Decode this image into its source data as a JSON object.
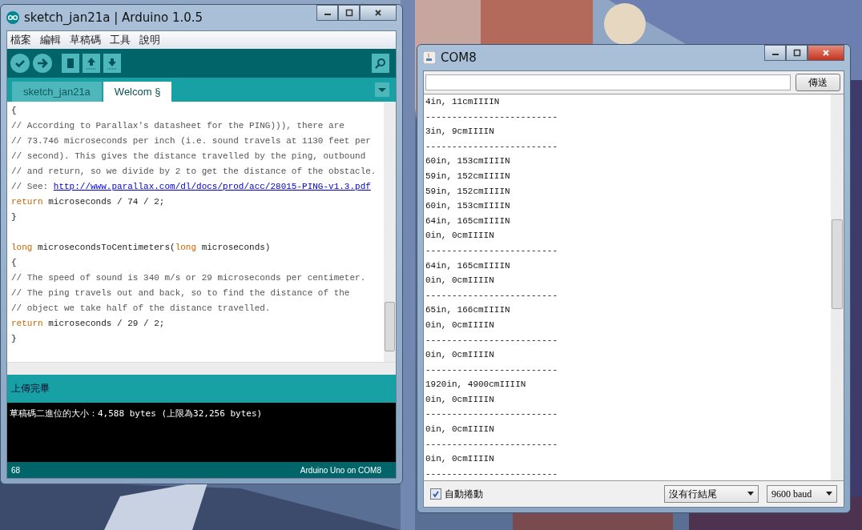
{
  "arduino": {
    "title": "sketch_jan21a | Arduino 1.0.5",
    "menu": [
      "檔案",
      "編輯",
      "草稿碼",
      "工具",
      "說明"
    ],
    "tabs": [
      {
        "label": "sketch_jan21a",
        "selected": false
      },
      {
        "label": "Welcom §",
        "selected": true
      }
    ],
    "code": [
      [
        {
          "kind": "plain",
          "text": "{"
        }
      ],
      [
        {
          "kind": "comment",
          "text": "// According to Parallax's datasheet for the PING))), there are"
        }
      ],
      [
        {
          "kind": "comment",
          "text": "// 73.746 microseconds per inch (i.e. sound travels at 1130 feet per"
        }
      ],
      [
        {
          "kind": "comment",
          "text": "// second). This gives the distance travelled by the ping, outbound"
        }
      ],
      [
        {
          "kind": "comment",
          "text": "// and return, so we divide by 2 to get the distance of the obstacle."
        }
      ],
      [
        {
          "kind": "comment",
          "text": "// See: "
        },
        {
          "kind": "link",
          "text": "http://www.parallax.com/dl/docs/prod/acc/28015-PING-v1.3.pdf"
        }
      ],
      [
        {
          "kind": "keyword",
          "text": "return"
        },
        {
          "kind": "plain",
          "text": " microseconds / 74 / 2;"
        }
      ],
      [
        {
          "kind": "plain",
          "text": "}"
        }
      ],
      [
        {
          "kind": "blank"
        }
      ],
      [
        {
          "kind": "keyword",
          "text": "long"
        },
        {
          "kind": "plain",
          "text": " microsecondsToCentimeters("
        },
        {
          "kind": "keyword",
          "text": "long"
        },
        {
          "kind": "plain",
          "text": " microseconds)"
        }
      ],
      [
        {
          "kind": "plain",
          "text": "{"
        }
      ],
      [
        {
          "kind": "comment",
          "text": "// The speed of sound is 340 m/s or 29 microseconds per centimeter."
        }
      ],
      [
        {
          "kind": "comment",
          "text": "// The ping travels out and back, so to find the distance of the"
        }
      ],
      [
        {
          "kind": "comment",
          "text": "// object we take half of the distance travelled."
        }
      ],
      [
        {
          "kind": "keyword",
          "text": "return"
        },
        {
          "kind": "plain",
          "text": " microseconds / 29 / 2;"
        }
      ],
      [
        {
          "kind": "plain",
          "text": "}"
        }
      ]
    ],
    "status": "上傳完畢",
    "console": [
      "草稿碼二進位的大小：4,588 bytes (上限為32,256 bytes)"
    ],
    "line_number": "68",
    "board": "Arduino Uno on COM8"
  },
  "serial": {
    "title": "COM8",
    "send_button": "傳送",
    "lines": [
      "4in, 11cmIIIIN",
      "-------------------------",
      "3in, 9cmIIIIN",
      "-------------------------",
      "60in, 153cmIIIIN",
      "59in, 152cmIIIIN",
      "59in, 152cmIIIIN",
      "60in, 153cmIIIIN",
      "64in, 165cmIIIIN",
      "0in, 0cmIIIIN",
      "-------------------------",
      "64in, 165cmIIIIN",
      "0in, 0cmIIIIN",
      "-------------------------",
      "65in, 166cmIIIIN",
      "0in, 0cmIIIIN",
      "-------------------------",
      "0in, 0cmIIIIN",
      "-------------------------",
      "1920in, 4900cmIIIIN",
      "0in, 0cmIIIIN",
      "-------------------------",
      "0in, 0cmIIIIN",
      "-------------------------",
      "0in, 0cmIIIIN",
      "-------------------------"
    ],
    "autoscroll": {
      "label": "自動捲動",
      "checked": true
    },
    "line_ending": "沒有行結尾",
    "baud": "9600 baud"
  }
}
